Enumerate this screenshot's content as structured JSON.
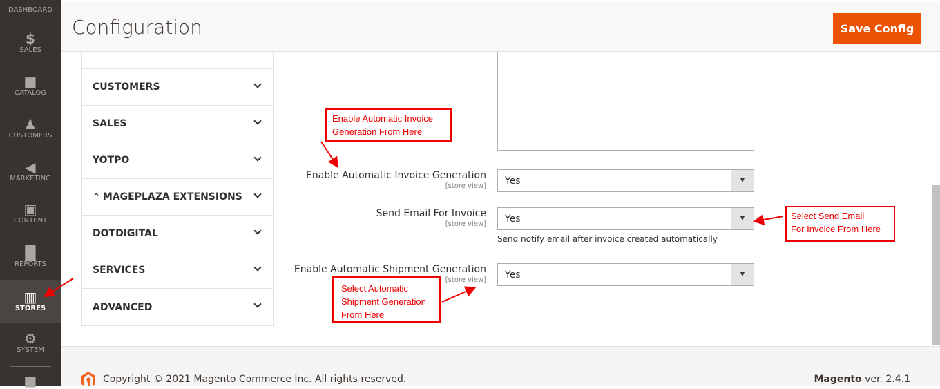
{
  "sidebar": {
    "items": [
      {
        "label": "DASHBOARD",
        "icon": "dashboard-icon"
      },
      {
        "label": "SALES",
        "icon": "dollar-icon"
      },
      {
        "label": "CATALOG",
        "icon": "box-icon"
      },
      {
        "label": "CUSTOMERS",
        "icon": "person-icon"
      },
      {
        "label": "MARKETING",
        "icon": "megaphone-icon"
      },
      {
        "label": "CONTENT",
        "icon": "layout-icon"
      },
      {
        "label": "REPORTS",
        "icon": "bar-chart-icon"
      },
      {
        "label": "STORES",
        "icon": "store-icon",
        "active": true
      },
      {
        "label": "SYSTEM",
        "icon": "gear-icon"
      }
    ]
  },
  "header": {
    "title": "Configuration",
    "save_label": "Save Config"
  },
  "nav": {
    "items": [
      "CUSTOMERS",
      "SALES",
      "YOTPO",
      "MAGEPLAZA EXTENSIONS",
      "DOTDIGITAL",
      "SERVICES",
      "ADVANCED"
    ]
  },
  "fields": [
    {
      "label": "Enable Automatic Invoice Generation",
      "scope": "[store view]",
      "value": "Yes"
    },
    {
      "label": "Send Email For Invoice",
      "scope": "[store view]",
      "value": "Yes",
      "note": "Send notify email after invoice created automatically"
    },
    {
      "label": "Enable Automatic Shipment Generation",
      "scope": "[store view]",
      "value": "Yes"
    }
  ],
  "annotations": {
    "invoice": [
      "Enable Automatic Invoice",
      "Generation From Here"
    ],
    "email": [
      "Select Send Email",
      "For Invoice From Here"
    ],
    "shipment": [
      "Select Automatic",
      "Shipment Generation",
      "From Here"
    ]
  },
  "footer": {
    "copyright": "Copyright © 2021 Magento Commerce Inc. All rights reserved.",
    "brand": "Magento",
    "version": " ver. 2.4.1"
  },
  "colors": {
    "accent": "#eb5202",
    "annotation": "#ee0000",
    "sidebar": "#373330"
  }
}
